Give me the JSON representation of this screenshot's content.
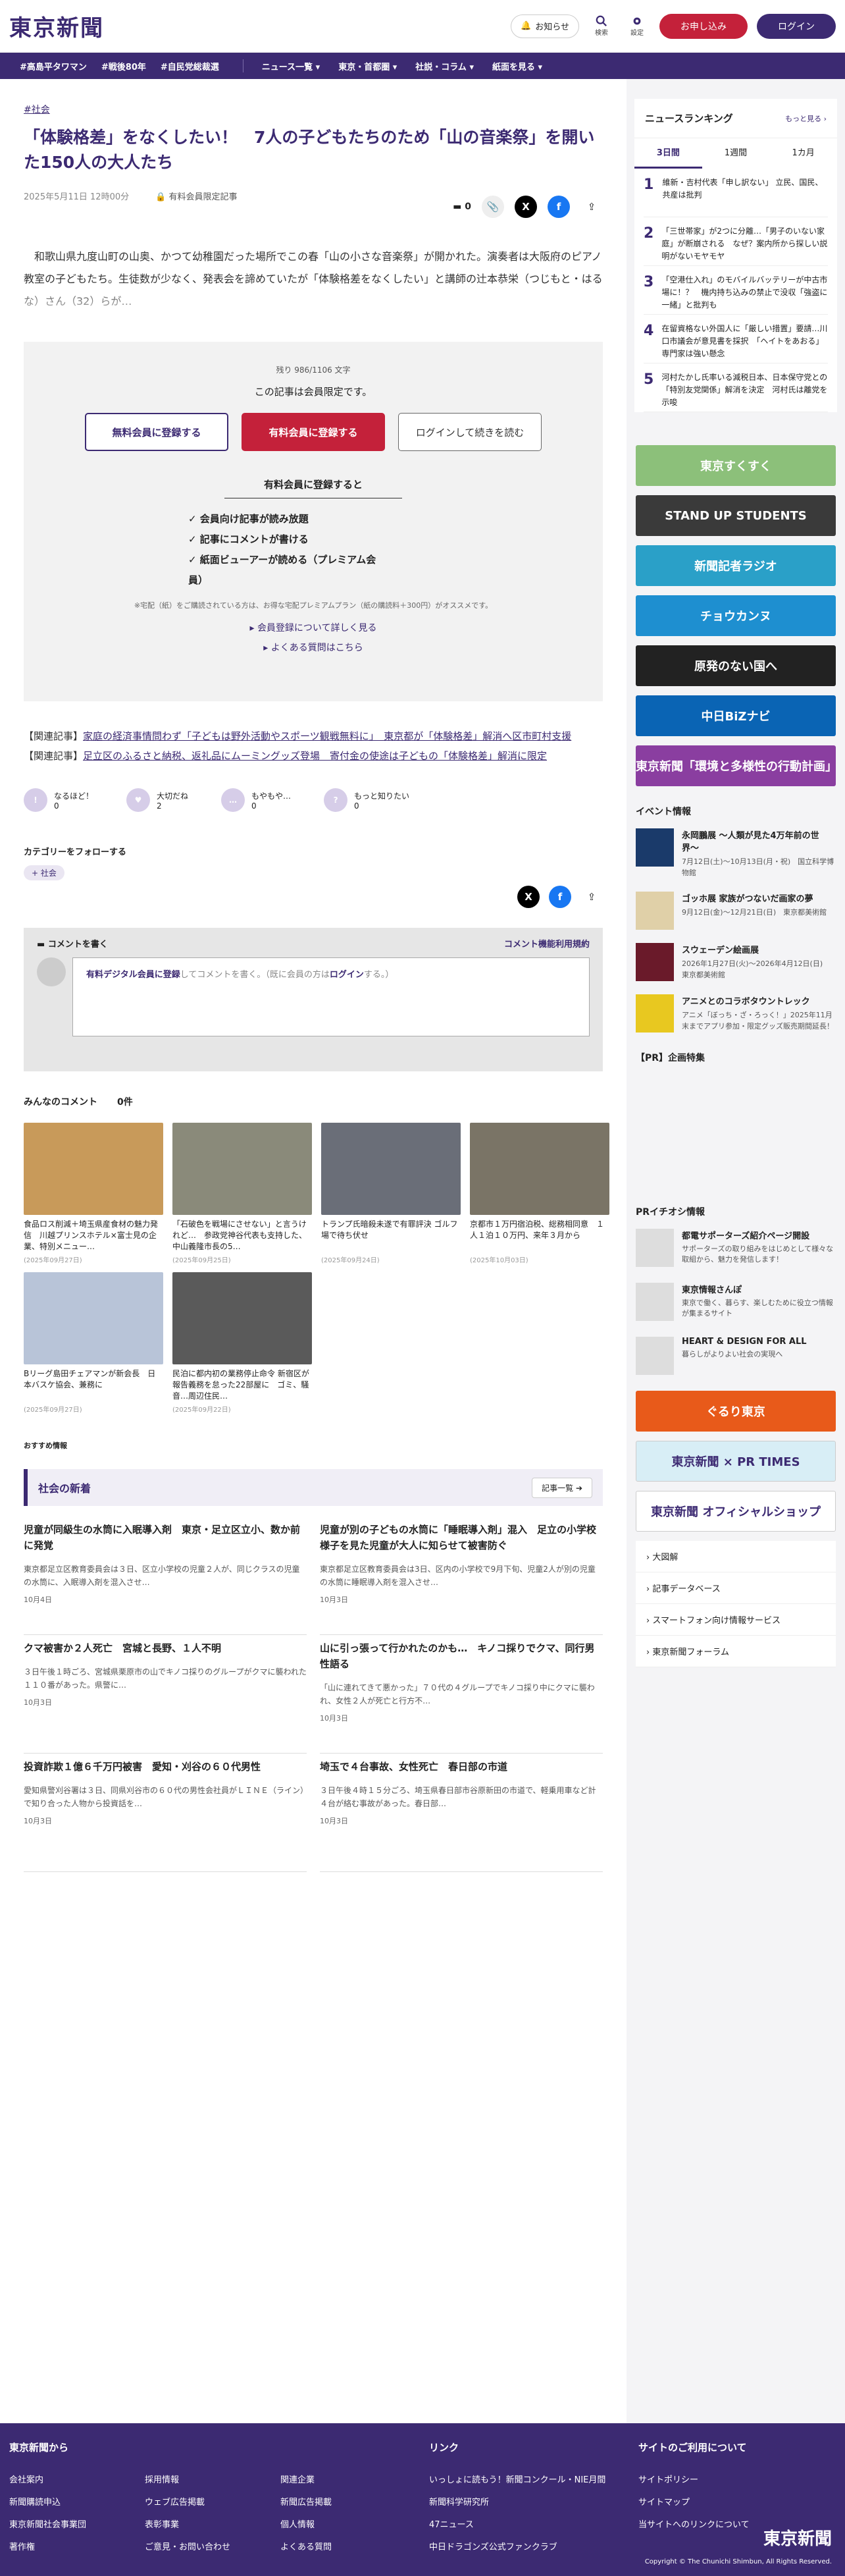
{
  "header": {
    "logo": "東京新聞",
    "notice": "お知らせ",
    "search": "検索",
    "settings": "設定",
    "subscribe": "お申し込み",
    "login": "ログイン"
  },
  "nav": {
    "tags": [
      "#高島平タワマン",
      "#戦後80年",
      "#自民党総裁選"
    ],
    "menus": [
      "ニュース一覧",
      "東京・首都圏",
      "社説・コラム",
      "紙面を見る"
    ]
  },
  "article": {
    "category": "#社会",
    "title": "「体験格差」をなくしたい！　7人の子どもたちのため「山の音楽祭」を開いた150人の大人たち",
    "date": "2025年5月11日 12時00分",
    "member": "有料会員限定記事",
    "comments": "0",
    "lead": "和歌山県九度山町の山奥、かつて幼稚園だった場所でこの春「山の小さな音楽祭」が開かれた。演奏者は大阪府のピアノ教室の子どもたち。生徒数が少なく、発表会を諦めていたが「体験格差をなくしたい」と講師の辻本恭栄（つじもと・はるな）さん（32）らが…",
    "paywall": {
      "remain": "残り 986/1106 文字",
      "limit": "この記事は会員限定です。",
      "free": "無料会員に登録する",
      "paid": "有料会員に登録する",
      "login": "ログインして続きを読む",
      "benefit": "有料会員に登録すると",
      "list": [
        "会員向け記事が読み放題",
        "記事にコメントが書ける",
        "紙面ビューアーが読める（プレミアム会員）"
      ],
      "note": "※宅配（紙）をご購読されている方は、お得な宅配プレミアムプラン（紙の購読料＋300円）がオススメです。",
      "link1": "会員登録について詳しく見る",
      "link2": "よくある質問はこちら"
    },
    "related": [
      {
        "label": "【関連記事】",
        "text": "家庭の経済事情問わず「子どもは野外活動やスポーツ観戦無料に」　東京都が「体験格差」解消へ区市町村支援"
      },
      {
        "label": "【関連記事】",
        "text": "足立区のふるさと納税、返礼品にムーミングッズ登場　寄付金の使途は子どもの「体験格差」解消に限定"
      }
    ],
    "reactions": [
      {
        "label": "なるほど！",
        "count": "0",
        "icon": "!"
      },
      {
        "label": "大切だね",
        "count": "2",
        "icon": "♥"
      },
      {
        "label": "もやもや…",
        "count": "0",
        "icon": "…"
      },
      {
        "label": "もっと知りたい",
        "count": "0",
        "icon": "?"
      }
    ],
    "follow": "カテゴリーをフォローする",
    "follow_tag": "社会"
  },
  "comment": {
    "title": "コメントを書く",
    "rules": "コメント機能利用規約",
    "cta_link": "有料デジタル会員に登録",
    "cta_mid": "してコメントを書く。（既に会員の方は",
    "cta_login": "ログイン",
    "cta_end": "する。）",
    "count_label": "みんなのコメント",
    "count": "0件"
  },
  "cards": [
    {
      "t": "食品ロス削減＋埼玉県産食材の魅力発信　川越プリンスホテル×富士見の企業、特別メニュー…",
      "d": "(2025年09月27日)",
      "c": "#c89a5a"
    },
    {
      "t": "「石破色を戦場にさせない」と言うけれど…　参政党神谷代表も支持した、中山義隆市長の5…",
      "d": "(2025年09月25日)",
      "c": "#8a8a7a"
    },
    {
      "t": "トランプ氏暗殺未遂で有罪評決 ゴルフ場で待ち伏せ",
      "d": "(2025年09月24日)",
      "c": "#6a6e78"
    },
    {
      "t": "京都市１万円宿泊税、総務相同意　１人１泊１０万円、来年３月から",
      "d": "(2025年10月03日)",
      "c": "#7a7466"
    },
    {
      "t": "Bリーグ島田チェアマンが新会長　日本バスケ協会、兼務に",
      "d": "(2025年09月27日)",
      "c": "#b8c4d8"
    },
    {
      "t": "民泊に都内初の業務停止命令 新宿区が報告義務を怠った22部屋に　ゴミ、騒音…周辺住民…",
      "d": "(2025年09月22日)",
      "c": "#5a5a5a"
    }
  ],
  "recommend": "おすすめ情報",
  "news": {
    "title": "社会の新着",
    "more": "記事一覧",
    "items": [
      {
        "t": "児童が同級生の水筒に入眠導入剤　東京・足立区立小、数か前に発覚",
        "s": "東京都足立区教育委員会は３日、区立小学校の児童２人が、同じクラスの児童の水筒に、入眠導入剤を混入させ…",
        "d": "10月4日"
      },
      {
        "t": "児童が別の子どもの水筒に「睡眠導入剤」混入　足立の小学校　様子を見た児童が大人に知らせて被害防ぐ",
        "s": "東京都足立区教育委員会は3日、区内の小学校で9月下旬、児童2人が別の児童の水筒に睡眠導入剤を混入させ…",
        "d": "10月3日"
      },
      {
        "t": "クマ被害か２人死亡　宮城と長野、１人不明",
        "s": "３日午後１時ごろ、宮城県栗原市の山でキノコ採りのグループがクマに襲われた１１０番があった。県警に…",
        "d": "10月3日"
      },
      {
        "t": "山に引っ張って行かれたのかも…　キノコ採りでクマ、同行男性語る",
        "s": "「山に連れてきて悪かった」７０代の４グループでキノコ採り中にクマに襲われ、女性２人が死亡と行方不…",
        "d": "10月3日"
      },
      {
        "t": "投資詐欺１億６千万円被害　愛知・刈谷の６０代男性",
        "s": "愛知県警刈谷署は３日、同県刈谷市の６０代の男性会社員がＬＩＮＥ（ライン）で知り合った人物から投資話を…",
        "d": "10月3日"
      },
      {
        "t": "埼玉で４台事故、女性死亡　春日部の市道",
        "s": "３日午後４時１５分ごろ、埼玉県春日部市谷原新田の市道で、軽乗用車など計４台が絡む事故があった。春日部…",
        "d": "10月3日"
      }
    ]
  },
  "side": {
    "rank_title": "ニュースランキング",
    "rank_more": "もっと見る",
    "tabs": [
      "3日間",
      "1週間",
      "1カ月"
    ],
    "rank": [
      {
        "n": "1",
        "t": "維新・吉村代表「申し訳ない」 立民、国民、共産は批判"
      },
      {
        "n": "2",
        "t": "「三世帯家」が2つに分離…「男子のいない家庭」が断崩される　なぜ？案内所から探しい説明がないモヤモヤ"
      },
      {
        "n": "3",
        "t": "「空港仕入れ」のモバイルバッテリーが中古市場に！？　機内持ち込みの禁止で没収「強盗に一緒」と批判も"
      },
      {
        "n": "4",
        "t": "在留資格ない外国人に「厳しい措置」要請…川口市議会が意見書を採択　「ヘイトをあおる」専門家は強い懸念"
      },
      {
        "n": "5",
        "t": "河村たかし氏率いる減税日本、日本保守党との「特別友党関係」解消を決定　河村氏は離党を示唆"
      }
    ],
    "banners": [
      {
        "text": "東京すくすく",
        "bg": "#8cc07a"
      },
      {
        "text": "STAND UP STUDENTS",
        "bg": "#3a3a3a"
      },
      {
        "text": "新聞記者ラジオ",
        "bg": "#2aa0c8"
      },
      {
        "text": "チョウカンヌ",
        "bg": "#1e8fd0"
      },
      {
        "text": "原発のない国へ",
        "bg": "#222222"
      },
      {
        "text": "中日BiZナビ",
        "bg": "#0a64b4"
      },
      {
        "text": "東京新聞「環境と多様性の行動計画」",
        "bg": "#8a3ea0"
      }
    ],
    "events_title": "イベント情報",
    "events": [
      {
        "t": "永岡鵬展 〜人類が見た4万年前の世界〜",
        "ds": "7月12日(土)〜10月13日(月・祝)　国立科学博物館",
        "c": "#1a3a6a"
      },
      {
        "t": "ゴッホ展 家族がつないだ画家の夢",
        "ds": "9月12日(金)〜12月21日(日)　東京都美術館",
        "c": "#e0d0a8"
      },
      {
        "t": "スウェーデン絵画展",
        "ds": "2026年1月27日(火)〜2026年4月12日(日)　東京都美術館",
        "c": "#6a1a2a"
      },
      {
        "t": "アニメとのコラボタウントレック",
        "ds": "アニメ「ぼっち・ざ・ろっく！」2025年11月末までアプリ参加・限定グッズ販売期間延長！",
        "c": "#e8c820"
      }
    ],
    "pr_title": "【PR】企画特集",
    "pr2_title": "PRイチオシ情報",
    "pr": [
      {
        "t": "都電サポーターズ紹介ページ開設",
        "ds": "サポーターズの取り組みをはじめとして様々な取組から、魅力を発信します！"
      },
      {
        "t": "東京情報さんぽ",
        "ds": "東京で働く、暮らす、楽しむために役立つ情報が集まるサイト"
      },
      {
        "t": "HEART & DESIGN FOR ALL",
        "ds": "暮らしがよりよい社会の実現へ"
      }
    ],
    "banners2": [
      {
        "text": "ぐるり東京",
        "bg": "#e85a1a"
      },
      {
        "text": "東京新聞 × PR TIMES",
        "bg": "#d8eef6"
      },
      {
        "text": "東京新聞 オフィシャルショップ",
        "bg": "#ffffff"
      }
    ],
    "links": [
      "大図解",
      "記事データベース",
      "スマートフォン向け情報サービス",
      "東京新聞フォーラム"
    ]
  },
  "footer": {
    "h1": "東京新聞から",
    "h2": "リンク",
    "h3": "サイトのご利用について",
    "c1": [
      "会社案内",
      "新聞購読申込",
      "東京新聞社会事業団",
      "著作権"
    ],
    "c2": [
      "採用情報",
      "ウェブ広告掲載",
      "表彰事業",
      "ご意見・お問い合わせ"
    ],
    "c3": [
      "関連企業",
      "新聞広告掲載",
      "個人情報",
      "よくある質問"
    ],
    "c4": [
      "いっしょに読もう！新聞コンクール・NIE月間",
      "新聞科学研究所",
      "47ニュース",
      "中日ドラゴンズ公式ファンクラブ"
    ],
    "c5": [
      "サイトポリシー",
      "サイトマップ",
      "当サイトへのリンクについて"
    ],
    "logo": "東京新聞",
    "copy": "Copyright © The Chunichi Shimbun, All Rights Reserved."
  }
}
